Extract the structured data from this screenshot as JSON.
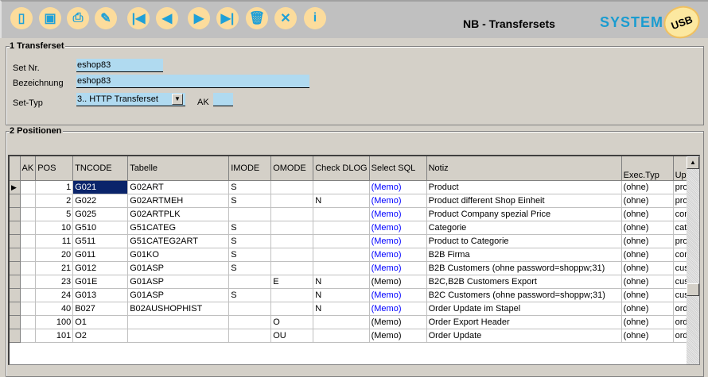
{
  "toolbar": {
    "buttons": [
      {
        "name": "new-document-icon",
        "glyph": "▯"
      },
      {
        "name": "save-icon",
        "glyph": "▣"
      },
      {
        "name": "print-icon",
        "glyph": "⎙"
      },
      {
        "name": "broom-icon",
        "glyph": "✎"
      },
      {
        "name": "first-record-icon",
        "glyph": "|◀"
      },
      {
        "name": "previous-record-icon",
        "glyph": "◀"
      },
      {
        "name": "next-record-icon",
        "glyph": "▶"
      },
      {
        "name": "last-record-icon",
        "glyph": "▶|"
      },
      {
        "name": "delete-trash-icon",
        "glyph": "🗑"
      },
      {
        "name": "cancel-x-icon",
        "glyph": "✕"
      },
      {
        "name": "info-icon",
        "glyph": "i"
      }
    ]
  },
  "header": {
    "title": "NB - Transfersets",
    "brand": "SYSTEM",
    "logo_text": "USB"
  },
  "transferset": {
    "group_label": "1 Transferset",
    "set_nr_label": "Set Nr.",
    "set_nr_value": "eshop83",
    "bezeichnung_label": "Bezeichnung",
    "bezeichnung_value": "eshop83",
    "set_typ_label": "Set-Typ",
    "set_typ_value": "3.. HTTP Transferset",
    "ak_label": "AK",
    "ak_value": ""
  },
  "positionen": {
    "group_label": "2 Positionen",
    "columns": [
      "AK",
      "POS",
      "TNCODE",
      "Tabelle",
      "IMODE",
      "OMODE",
      "Check DLOG",
      "Select SQL",
      "Notiz",
      "Exec.Typ",
      "Up.."
    ],
    "rows": [
      [
        "",
        "1",
        "G021",
        "G02ART",
        "S",
        "",
        "",
        "(Memo)",
        "Product",
        "(ohne)",
        "proc"
      ],
      [
        "",
        "2",
        "G022",
        "G02ARTMEH",
        "S",
        "",
        "N",
        "(Memo)",
        "Product different Shop Einheit",
        "(ohne)",
        "proc"
      ],
      [
        "",
        "5",
        "G025",
        "G02ARTPLK",
        "",
        "",
        "",
        "(Memo)",
        "Product Company spezial Price",
        "(ohne)",
        "com"
      ],
      [
        "",
        "10",
        "G510",
        "G51CATEG",
        "S",
        "",
        "",
        "(Memo)",
        "Categorie",
        "(ohne)",
        "cate"
      ],
      [
        "",
        "11",
        "G511",
        "G51CATEG2ART",
        "S",
        "",
        "",
        "(Memo)",
        "Product to Categorie",
        "(ohne)",
        "proc"
      ],
      [
        "",
        "20",
        "G011",
        "G01KO",
        "S",
        "",
        "",
        "(Memo)",
        "B2B Firma",
        "(ohne)",
        "com"
      ],
      [
        "",
        "21",
        "G012",
        "G01ASP",
        "S",
        "",
        "",
        "(Memo)",
        "B2B Customers (ohne password=shoppw;31)",
        "(ohne)",
        "cus"
      ],
      [
        "",
        "23",
        "G01E",
        "G01ASP",
        "",
        "E",
        "N",
        "(Memo)",
        "B2C,B2B Customers Export",
        "(ohne)",
        "cus"
      ],
      [
        "",
        "24",
        "G013",
        "G01ASP",
        "S",
        "",
        "N",
        "(Memo)",
        "B2C Customers (ohne password=shoppw;31)",
        "(ohne)",
        "cus"
      ],
      [
        "",
        "40",
        "B027",
        "B02AUSHOPHIST",
        "",
        "",
        "N",
        "(Memo)",
        "Order Update im Stapel",
        "(ohne)",
        "orde"
      ],
      [
        "",
        "100",
        "O1",
        "",
        "",
        "O",
        "",
        "(Memo)",
        "Order Export Header",
        "(ohne)",
        "orde"
      ],
      [
        "",
        "101",
        "O2",
        "",
        "",
        "OU",
        "",
        "(Memo)",
        "Order Update",
        "(ohne)",
        "orde"
      ]
    ],
    "memo_blue": [
      true,
      true,
      true,
      true,
      true,
      true,
      true,
      false,
      true,
      true,
      false,
      false
    ],
    "selected_row": 0
  },
  "colors": {
    "toolbar": "#c0c0c0",
    "form": "#d4d0c8",
    "input": "#b0daf0",
    "icon_bg": "#fcdc9c",
    "icon_fg": "#1ea0d8",
    "brand": "#1a9cd0",
    "selection": "#0a246a",
    "memo_link": "#0000ff"
  }
}
